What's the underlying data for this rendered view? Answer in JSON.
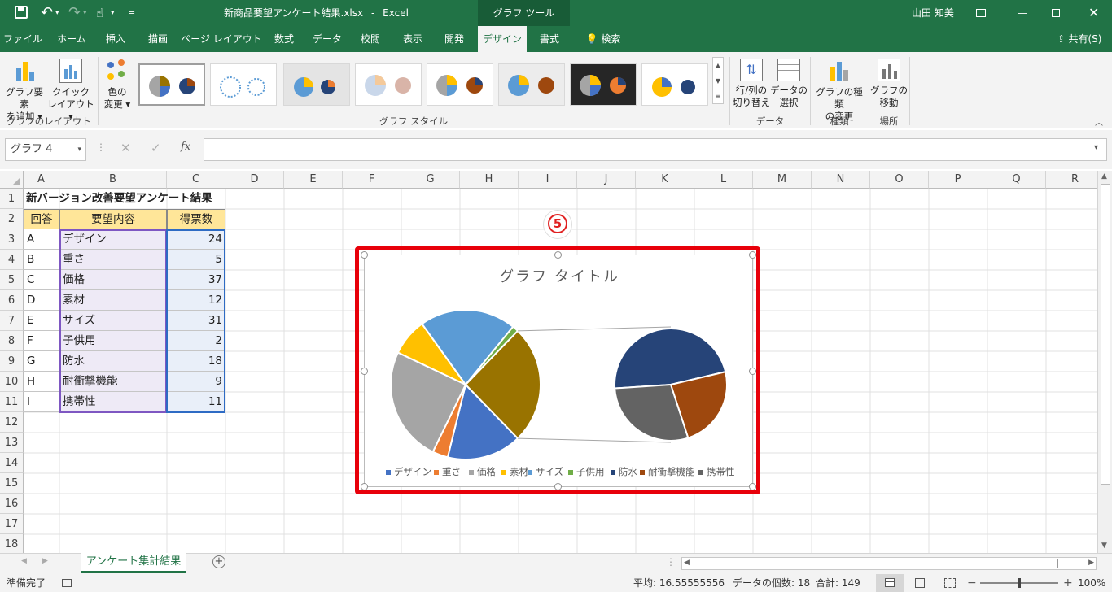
{
  "window": {
    "filename": "新商品要望アンケート結果.xlsx",
    "separator": "-",
    "app": "Excel",
    "context_tab": "グラフ ツール",
    "user": "山田 知美",
    "qat_customize": "="
  },
  "tabs": [
    "ファイル",
    "ホーム",
    "挿入",
    "描画",
    "ページ レイアウト",
    "数式",
    "データ",
    "校閲",
    "表示",
    "開発",
    "デザイン",
    "書式"
  ],
  "search_label": "検索",
  "share_label": "共有(S)",
  "ribbon": {
    "add_element": [
      "グラフ要素",
      "を追加"
    ],
    "quick_layout": [
      "クイック",
      "レイアウト"
    ],
    "change_color": [
      "色の",
      "変更"
    ],
    "switch_rowcol": [
      "行/列の",
      "切り替え"
    ],
    "select_data": [
      "データの",
      "選択"
    ],
    "change_type": [
      "グラフの種類",
      "の変更"
    ],
    "move_chart": [
      "グラフの",
      "移動"
    ],
    "groups": {
      "layout": "グラフのレイアウト",
      "styles": "グラフ スタイル",
      "data": "データ",
      "type": "種類",
      "location": "場所"
    }
  },
  "formula_bar": {
    "name_box": "グラフ 4",
    "fx": "fx",
    "value": ""
  },
  "columns": [
    "A",
    "B",
    "C",
    "D",
    "E",
    "F",
    "G",
    "H",
    "I",
    "J",
    "K",
    "L",
    "M",
    "N",
    "O",
    "P",
    "Q",
    "R"
  ],
  "rows": [
    "1",
    "2",
    "3",
    "4",
    "5",
    "6",
    "7",
    "8",
    "9",
    "10",
    "11",
    "12",
    "13",
    "14",
    "15",
    "16",
    "17",
    "18"
  ],
  "sheet": {
    "title": "新バージョン改善要望アンケート結果",
    "headers": [
      "回答",
      "要望内容",
      "得票数"
    ],
    "data": [
      [
        "A",
        "デザイン",
        "24"
      ],
      [
        "B",
        "重さ",
        "5"
      ],
      [
        "C",
        "価格",
        "37"
      ],
      [
        "D",
        "素材",
        "12"
      ],
      [
        "E",
        "サイズ",
        "31"
      ],
      [
        "F",
        "子供用",
        "2"
      ],
      [
        "G",
        "防水",
        "18"
      ],
      [
        "H",
        "耐衝撃機能",
        "9"
      ],
      [
        "I",
        "携帯性",
        "11"
      ]
    ]
  },
  "step_marker": "5",
  "chart_data": {
    "type": "pie",
    "subtype": "pie-of-pie",
    "title": "グラフ タイトル",
    "categories": [
      "デザイン",
      "重さ",
      "価格",
      "素材",
      "サイズ",
      "子供用",
      "防水",
      "耐衝撃機能",
      "携帯性"
    ],
    "values": [
      24,
      5,
      37,
      12,
      31,
      2,
      18,
      9,
      11
    ],
    "colors": [
      "#4472c4",
      "#ed7d31",
      "#a5a5a5",
      "#ffc000",
      "#5b9bd5",
      "#70ad47",
      "#264478",
      "#9e480e",
      "#636363"
    ],
    "secondary_count": 3,
    "secondary_color": "#997300",
    "legend_position": "bottom"
  },
  "sheet_tab": "アンケート集計結果",
  "status": {
    "ready": "準備完了",
    "average": "平均: 16.55555556",
    "count": "データの個数: 18",
    "sum": "合計: 149",
    "zoom": "100%"
  }
}
